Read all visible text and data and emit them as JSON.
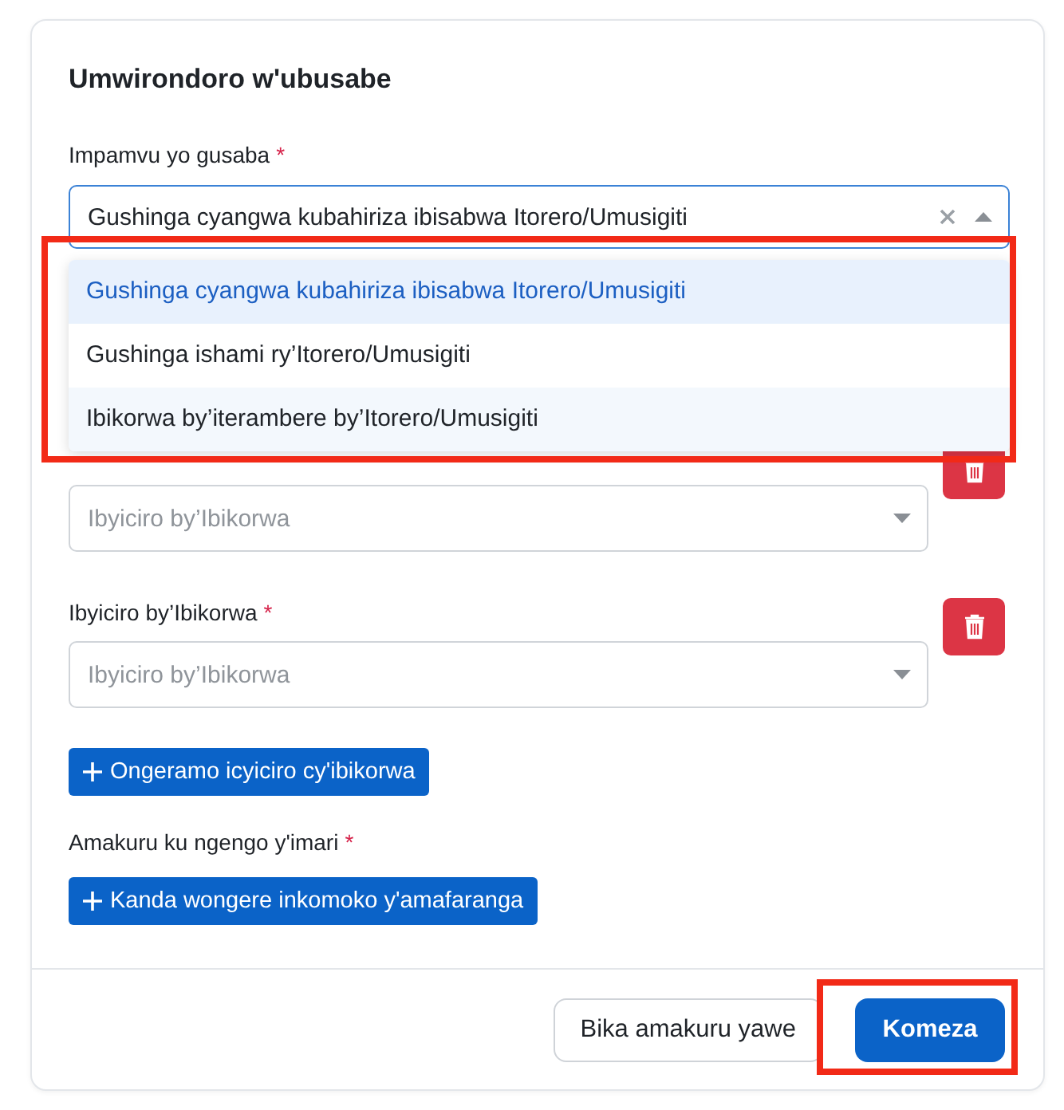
{
  "title": "Umwirondoro w'ubusabe",
  "reason": {
    "label": "Impamvu yo gusaba",
    "required_mark": "*",
    "value": "Gushinga cyangwa kubahiriza ibisabwa Itorero/Umusigiti",
    "open": true,
    "highlighted": true,
    "options": [
      {
        "label": "Gushinga cyangwa kubahiriza ibisabwa Itorero/Umusigiti",
        "selected": true,
        "hovered": false
      },
      {
        "label": "Gushinga ishami ry’Itorero/Umusigiti",
        "selected": false,
        "hovered": false
      },
      {
        "label": "Ibikorwa by’iterambere by’Itorero/Umusigiti",
        "selected": false,
        "hovered": true
      }
    ]
  },
  "stages": [
    {
      "placeholder": "Ibyiciro by’Ibikorwa"
    },
    {
      "label": "Ibyiciro by’Ibikorwa",
      "required_mark": "*",
      "placeholder": "Ibyiciro by’Ibikorwa"
    }
  ],
  "add_stage_button": "Ongeramo icyiciro cy'ibikorwa",
  "finance": {
    "label": "Amakuru ku ngengo y'imari",
    "required_mark": "*",
    "button": "Kanda wongere inkomoko y'amafaranga"
  },
  "footer_buttons": [
    {
      "label": "Bika amakuru yawe",
      "kind": "secondary",
      "highlighted": false
    },
    {
      "label": "Komeza",
      "kind": "primary",
      "highlighted": true
    }
  ]
}
